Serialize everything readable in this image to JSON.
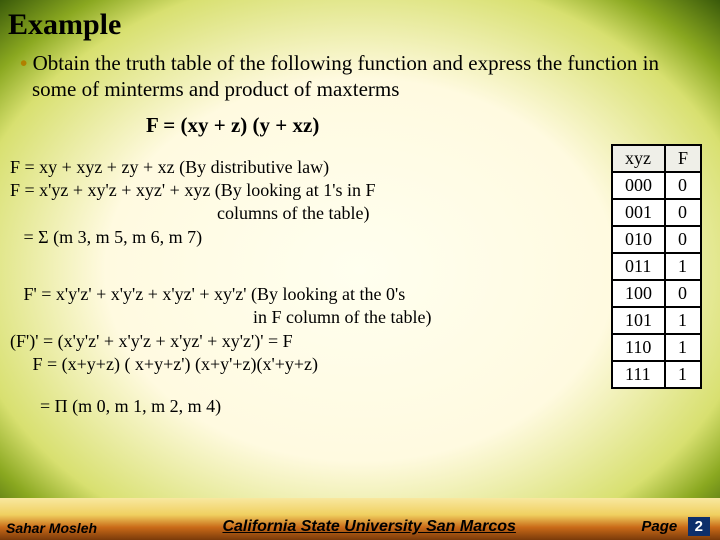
{
  "title": "Example",
  "bullet": "Obtain the truth table of the following  function and express the function in some of minterms and product of maxterms",
  "formula": "F = (xy + z) (y + xz)",
  "block1": {
    "l1": "F = xy + xyz + zy + xz (By distributive law)",
    "l2": "F = x'yz + xy'z + xyz' + xyz (By looking at 1's in F",
    "l3": "                                              columns of the table)",
    "l4": "   = Σ  (m 3, m 5, m 6, m 7)"
  },
  "block2": {
    "l1": "   F' = x'y'z' + x'y'z + x'yz' + xy'z' (By looking at the 0's",
    "l2": "                                                      in F column of the table)",
    "l3": "(F')' = (x'y'z' + x'y'z + x'yz' + xy'z')' = F",
    "l4": "     F = (x+y+z) ( x+y+z') (x+y'+z)(x'+y+z)"
  },
  "block3": "= Π (m 0, m 1, m 2, m 4)",
  "table": {
    "headers": [
      "xyz",
      "F"
    ],
    "rows": [
      [
        "000",
        "0"
      ],
      [
        "001",
        "0"
      ],
      [
        "010",
        "0"
      ],
      [
        "011",
        "1"
      ],
      [
        "100",
        "0"
      ],
      [
        "101",
        "1"
      ],
      [
        "110",
        "1"
      ],
      [
        "111",
        "1"
      ]
    ]
  },
  "footer": {
    "author": "Sahar Mosleh",
    "uni": "California State University San Marcos",
    "page_label": "Page",
    "page_num": "2"
  },
  "chart_data": {
    "type": "table",
    "title": "Truth table for F = (xy + z)(y + xz)",
    "columns": [
      "xyz",
      "F"
    ],
    "rows": [
      {
        "xyz": "000",
        "F": 0
      },
      {
        "xyz": "001",
        "F": 0
      },
      {
        "xyz": "010",
        "F": 0
      },
      {
        "xyz": "011",
        "F": 1
      },
      {
        "xyz": "100",
        "F": 0
      },
      {
        "xyz": "101",
        "F": 1
      },
      {
        "xyz": "110",
        "F": 1
      },
      {
        "xyz": "111",
        "F": 1
      }
    ],
    "minterms": [
      3,
      5,
      6,
      7
    ],
    "maxterms": [
      0,
      1,
      2,
      4
    ]
  }
}
